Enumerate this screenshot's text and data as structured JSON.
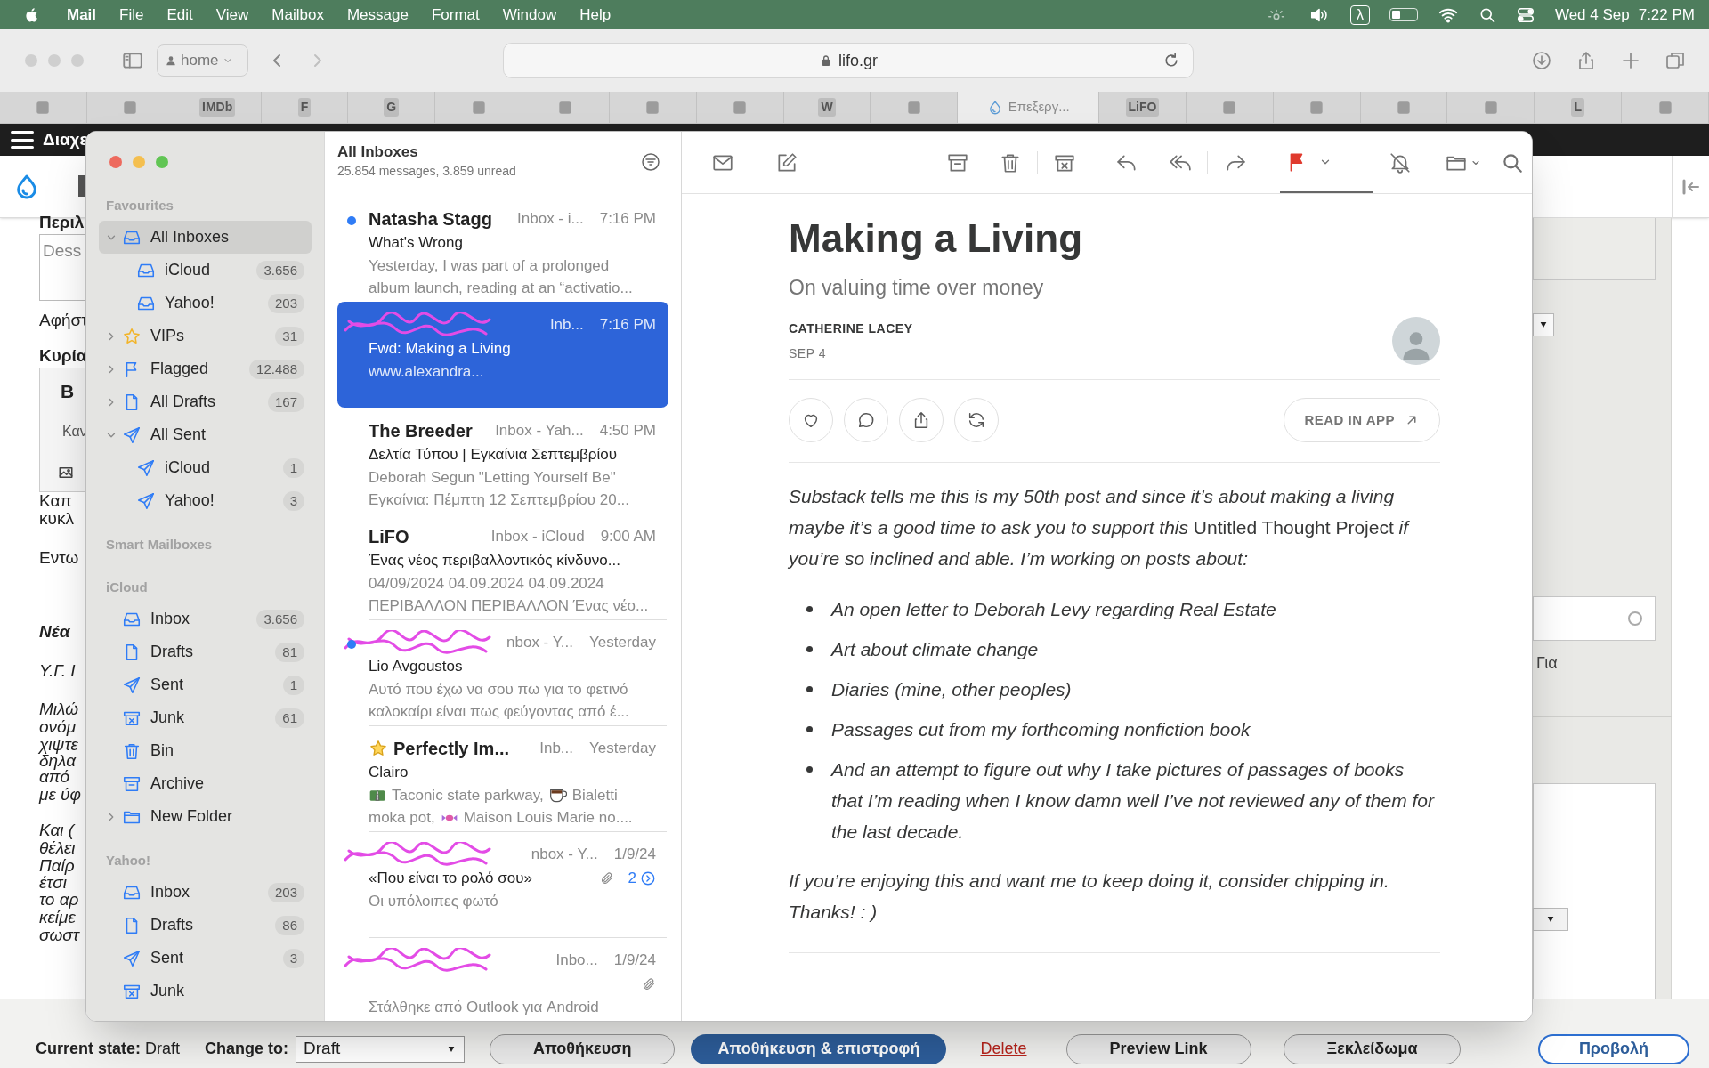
{
  "menubar": {
    "app": "Mail",
    "menus": [
      "File",
      "Edit",
      "View",
      "Mailbox",
      "Message",
      "Format",
      "Window",
      "Help"
    ],
    "input_source": "λ",
    "date": "Wed 4 Sep",
    "time": "7:22 PM"
  },
  "browser": {
    "profile": "home",
    "address": "lifo.gr",
    "tabs": [
      {
        "selected": false
      },
      {
        "selected": false
      },
      {
        "selected": false,
        "glyph": "IMDb"
      },
      {
        "selected": false,
        "glyph": "F"
      },
      {
        "selected": false,
        "glyph": "G"
      },
      {
        "selected": false
      },
      {
        "selected": false
      },
      {
        "selected": false
      },
      {
        "selected": false
      },
      {
        "selected": false,
        "glyph": "W"
      },
      {
        "selected": false
      },
      {
        "selected": true,
        "label": "Επεξεργ..."
      },
      {
        "selected": false,
        "glyph": "LiFO"
      },
      {
        "selected": false
      },
      {
        "selected": false
      },
      {
        "selected": false
      },
      {
        "selected": false
      },
      {
        "selected": false,
        "glyph": "L"
      },
      {
        "selected": false
      }
    ]
  },
  "background_page": {
    "header": "Διαχε",
    "left_lines": [
      {
        "kind": "bold",
        "text": "Περιλ"
      },
      {
        "kind": "placeholder",
        "text": "Dess"
      },
      {
        "kind": "normal",
        "text": "Αφήστ"
      },
      {
        "kind": "bold",
        "text": "Κυρία"
      },
      {
        "kind": "toolbar-bold",
        "text": "B"
      },
      {
        "kind": "toolbar",
        "text": "Καν"
      },
      {
        "kind": "normal",
        "text": "Καπ"
      },
      {
        "kind": "normal",
        "text": "κυκλ"
      },
      {
        "kind": "normal",
        "text": "Εντω"
      },
      {
        "kind": "bold-italic",
        "text": "Νέα"
      },
      {
        "kind": "italic",
        "text": "Υ.Γ. Ι"
      },
      {
        "kind": "italic",
        "text": "Μιλώ"
      },
      {
        "kind": "italic",
        "text": "ονόμ"
      },
      {
        "kind": "italic",
        "text": "χιψτε"
      },
      {
        "kind": "italic",
        "text": "δηλα"
      },
      {
        "kind": "italic",
        "text": "από"
      },
      {
        "kind": "italic",
        "text": "με ύφ"
      },
      {
        "kind": "italic",
        "text": "Και ("
      },
      {
        "kind": "italic",
        "text": "θέλει"
      },
      {
        "kind": "italic",
        "text": "Παίρ"
      },
      {
        "kind": "italic",
        "text": "έτσι"
      },
      {
        "kind": "italic",
        "text": "το αρ"
      },
      {
        "kind": "italic",
        "text": "κείμε"
      },
      {
        "kind": "italic",
        "text": "σωστ"
      }
    ],
    "right_label": "Για",
    "bottom_bar": {
      "state_label": "Current state:",
      "state_value": "Draft",
      "change_label": "Change to:",
      "change_value": "Draft",
      "buttons": [
        {
          "kind": "default",
          "label": "Αποθήκευση"
        },
        {
          "kind": "primary",
          "label": "Αποθήκευση & επιστροφή"
        },
        {
          "kind": "link",
          "label": "Delete"
        },
        {
          "kind": "default",
          "label": "Preview Link"
        },
        {
          "kind": "default",
          "label": "Ξεκλείδωμα"
        }
      ],
      "preview_button": "Προβολή"
    }
  },
  "mail": {
    "sidebar": [
      {
        "heading": "Favourites",
        "items": [
          {
            "kind": "inbox",
            "label": "All Inboxes",
            "selected": true,
            "expanded": true,
            "children": [
              {
                "kind": "inbox",
                "label": "iCloud",
                "count": "3.656",
                "selected": false
              },
              {
                "kind": "inbox",
                "label": "Yahoo!",
                "count": "203",
                "selected": false
              }
            ]
          },
          {
            "kind": "star",
            "label": "VIPs",
            "count": "31",
            "selected": false,
            "expanded": false
          },
          {
            "kind": "flag",
            "label": "Flagged",
            "count": "12.488",
            "selected": false,
            "expanded": false
          },
          {
            "kind": "draft",
            "label": "All Drafts",
            "count": "167",
            "selected": false,
            "expanded": false
          },
          {
            "kind": "sent",
            "label": "All Sent",
            "selected": false,
            "expanded": true,
            "children": [
              {
                "kind": "sent",
                "label": "iCloud",
                "count": "1",
                "selected": false
              },
              {
                "kind": "sent",
                "label": "Yahoo!",
                "count": "3",
                "selected": false
              }
            ]
          }
        ]
      },
      {
        "heading": "Smart Mailboxes"
      },
      {
        "heading": "iCloud",
        "items": [
          {
            "kind": "inbox",
            "label": "Inbox",
            "count": "3.656",
            "selected": false
          },
          {
            "kind": "draft",
            "label": "Drafts",
            "count": "81",
            "selected": false
          },
          {
            "kind": "sent",
            "label": "Sent",
            "count": "1",
            "selected": false
          },
          {
            "kind": "junk",
            "label": "Junk",
            "count": "61",
            "selected": false
          },
          {
            "kind": "bin",
            "label": "Bin",
            "selected": false
          },
          {
            "kind": "archive",
            "label": "Archive",
            "selected": false
          },
          {
            "kind": "folder",
            "label": "New Folder",
            "selected": false,
            "expanded": false
          }
        ]
      },
      {
        "heading": "Yahoo!",
        "items": [
          {
            "kind": "inbox",
            "label": "Inbox",
            "count": "203",
            "selected": false
          },
          {
            "kind": "draft",
            "label": "Drafts",
            "count": "86",
            "selected": false
          },
          {
            "kind": "sent",
            "label": "Sent",
            "count": "3",
            "selected": false
          },
          {
            "kind": "junk",
            "label": "Junk",
            "selected": false
          }
        ]
      }
    ],
    "list": {
      "title": "All Inboxes",
      "summary": "25.854 messages, 3.859 unread",
      "messages": [
        {
          "sender": "Natasha Stagg",
          "mailbox": "Inbox - i...",
          "time": "7:16 PM",
          "subject": "What's Wrong",
          "preview": [
            [
              {
                "text": "Yesterday, I was part of a prolonged"
              }
            ],
            [
              {
                "text": "album launch, reading at an “activatio..."
              }
            ]
          ],
          "unread": true,
          "selected": false
        },
        {
          "redacted": true,
          "mailbox": "Inb...",
          "time": "7:16 PM",
          "subject": "Fwd: Making a Living",
          "preview": [
            [
              {
                "text": "www.alexandra..."
              }
            ]
          ],
          "unread": false,
          "selected": true
        },
        {
          "sender": "The Breeder",
          "mailbox": "Inbox - Yah...",
          "time": "4:50 PM",
          "subject": "Δελτία Τύπου | Εγκαίνια Σεπτεμβρίου",
          "preview": [
            [
              {
                "text": "Deborah Segun \"Letting Yourself Be\""
              }
            ],
            [
              {
                "text": "Εγκαίνια: Πέμπτη 12 Σεπτεμβρίου 20..."
              }
            ]
          ],
          "unread": false,
          "selected": false
        },
        {
          "sender": "LiFO",
          "mailbox": "Inbox - iCloud",
          "time": "9:00 AM",
          "subject": "Ένας νέος περιβαλλοντικός κίνδυνο...",
          "preview": [
            [
              {
                "text": "04/09/2024 04.09.2024 04.09.2024"
              }
            ],
            [
              {
                "text": "ΠΕΡΙΒΑΛΛΟΝ ΠΕΡΙΒΑΛΛΟΝ Ένας νέο..."
              }
            ]
          ],
          "unread": false,
          "selected": false
        },
        {
          "redacted": true,
          "mailbox": "nbox - Y...",
          "time": "Yesterday",
          "subject": "Lio Avgoustos",
          "preview": [
            [
              {
                "text": "Αυτό που έχω να σου πω για το φετινό"
              }
            ],
            [
              {
                "text": "καλοκαίρι είναι πως φεύγοντας από έ..."
              }
            ]
          ],
          "unread": true,
          "selected": false
        },
        {
          "sender": "Perfectly Im...",
          "vip": true,
          "mailbox": "Inb...",
          "time": "Yesterday",
          "subject": "Clairo",
          "preview": [
            [
              {
                "kind": "road"
              },
              {
                "text": "Taconic state parkway,"
              },
              {
                "kind": "cup"
              },
              {
                "text": "Bialetti"
              }
            ],
            [
              {
                "text": "moka pot,"
              },
              {
                "kind": "candy"
              },
              {
                "text": "Maison Louis Marie no...."
              }
            ]
          ],
          "unread": false,
          "selected": false
        },
        {
          "redacted": true,
          "mailbox": "nbox - Y...",
          "time": "1/9/24",
          "subject": "«Που είναι το ρολό σου»",
          "attachment": true,
          "thread_count": "2",
          "preview": [
            [
              {
                "text": "Οι υπόλοιπες φωτό"
              }
            ]
          ],
          "unread": false,
          "selected": false
        },
        {
          "redacted": true,
          "mailbox": "Inbo...",
          "time": "1/9/24",
          "attachment": true,
          "preview": [
            [
              {
                "text": "Στάλθηκε από Outlook για Android"
              }
            ]
          ],
          "unread": false,
          "selected": false
        }
      ]
    },
    "toolbar": {
      "flagged": true
    },
    "article": {
      "title": "Making a Living",
      "subtitle": "On valuing time over money",
      "author": "CATHERINE LACEY",
      "date": "SEP 4",
      "read_in_app": "READ IN APP",
      "intro": "*Substack tells me this is my 50th post and since it’s about making a living maybe it’s a good time to ask you to support this* Untitled Thought Project *if you’re so inclined and able. I’m working on posts about:*",
      "bullets": [
        "An open letter to Deborah Levy regarding Real Estate",
        "Art about climate change",
        "Diaries (mine, other peoples)",
        "Passages cut from my forthcoming nonfiction book",
        "And an attempt to figure out why I take pictures of passages of books that I’m reading when I know damn well I’ve not reviewed any of them for the last decade."
      ],
      "closing": "If you’re enjoying this and want me to keep doing it, consider chipping in. Thanks! : )"
    }
  }
}
